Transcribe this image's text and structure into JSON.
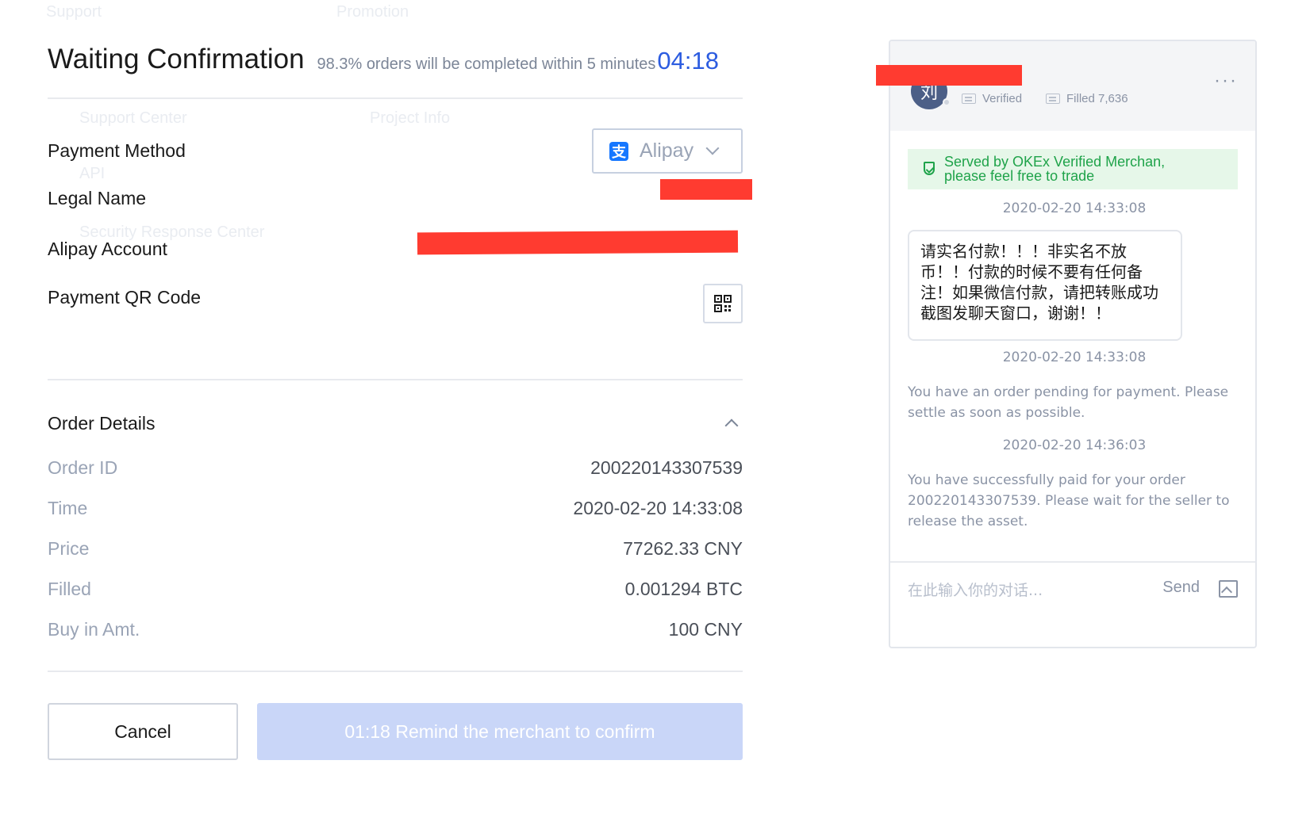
{
  "background_menu": {
    "top_left": "Support",
    "top_right": "Promotion",
    "support_center": "Support Center",
    "project_info": "Project Info",
    "api": "API",
    "security_response_center": "Security Response Center"
  },
  "header": {
    "title": "Waiting Confirmation",
    "subtitle": "98.3% orders will be completed within 5 minutes",
    "countdown": "04:18"
  },
  "payment": {
    "method_label": "Payment Method",
    "method_value": "Alipay",
    "method_icon_glyph": "支",
    "method_icon": "alipay-icon",
    "legal_name_label": "Legal Name",
    "account_label": "Alipay Account",
    "qr_label": "Payment QR Code",
    "qr_icon": "qr-code-icon"
  },
  "order_details": {
    "title": "Order Details",
    "rows": [
      {
        "key": "Order ID",
        "value": "200220143307539"
      },
      {
        "key": "Time",
        "value": "2020-02-20 14:33:08"
      },
      {
        "key": "Price",
        "value": "77262.33 CNY"
      },
      {
        "key": "Filled",
        "value": "0.001294 BTC"
      },
      {
        "key": "Buy in Amt.",
        "value": "100 CNY"
      }
    ]
  },
  "actions": {
    "cancel_label": "Cancel",
    "remind_label": "01:18 Remind the merchant to confirm"
  },
  "chat": {
    "avatar_text": "刘",
    "verified_label": "Verified",
    "filled_label": "Filled 7,636",
    "more_icon": "more-icon",
    "banner_line1": "Served by OKEx Verified Merchan,",
    "banner_line2": "please feel free to trade",
    "messages": [
      {
        "time": "2020-02-20 14:33:08",
        "text": "请实名付款！！！非实名不放币！！付款的时候不要有任何备注！如果微信付款，请把转账成功截图发聊天窗口，谢谢！！"
      },
      {
        "time": "2020-02-20 14:33:08",
        "text": "You have an order pending for payment. Please settle as soon as possible."
      },
      {
        "time": "2020-02-20 14:36:03",
        "text": "You have successfully paid for your order 200220143307539. Please wait for the seller to release the asset."
      }
    ],
    "input_placeholder": "在此输入你的对话...",
    "send_label": "Send",
    "image_icon": "image-upload-icon"
  },
  "colors": {
    "accent": "#2c5ce0",
    "redaction": "#ff3b30",
    "success": "#1fa34a",
    "remind_button": "#c9d6f8"
  }
}
